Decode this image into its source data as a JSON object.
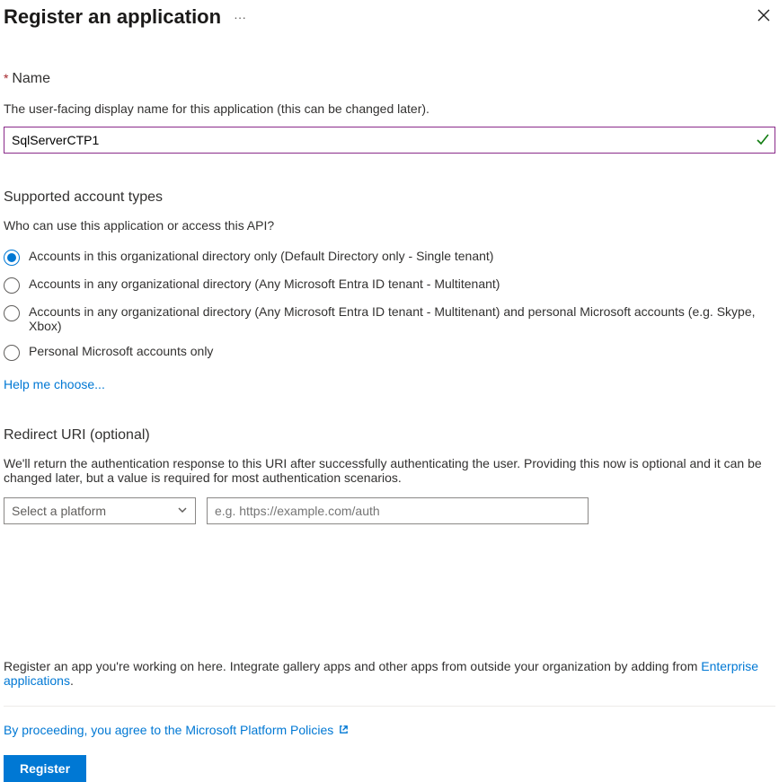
{
  "header": {
    "title": "Register an application"
  },
  "name": {
    "required_mark": "*",
    "label": "Name",
    "help": "The user-facing display name for this application (this can be changed later).",
    "value": "SqlServerCTP1"
  },
  "accountTypes": {
    "title": "Supported account types",
    "question": "Who can use this application or access this API?",
    "options": [
      "Accounts in this organizational directory only (Default Directory only - Single tenant)",
      "Accounts in any organizational directory (Any Microsoft Entra ID tenant - Multitenant)",
      "Accounts in any organizational directory (Any Microsoft Entra ID tenant - Multitenant) and personal Microsoft accounts (e.g. Skype, Xbox)",
      "Personal Microsoft accounts only"
    ],
    "helpLink": "Help me choose..."
  },
  "redirect": {
    "title": "Redirect URI (optional)",
    "description": "We'll return the authentication response to this URI after successfully authenticating the user. Providing this now is optional and it can be changed later, but a value is required for most authentication scenarios.",
    "platformPlaceholder": "Select a platform",
    "uriPlaceholder": "e.g. https://example.com/auth"
  },
  "bottom": {
    "textPrefix": "Register an app you're working on here. Integrate gallery apps and other apps from outside your organization by adding from ",
    "enterpriseLink": "Enterprise applications",
    "period": ".",
    "policies": "By proceeding, you agree to the Microsoft Platform Policies",
    "registerLabel": "Register"
  }
}
